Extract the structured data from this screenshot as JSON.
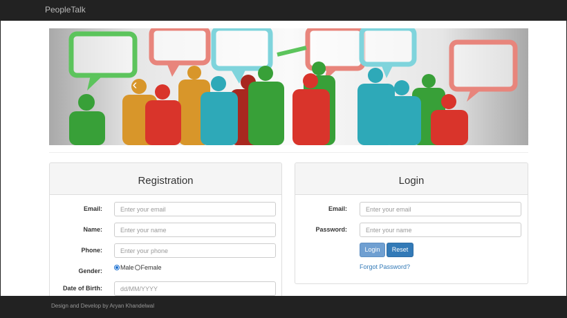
{
  "navbar": {
    "brand": "PeopleTalk"
  },
  "carousel": {
    "prev_icon": "chevron-left-icon",
    "next_icon": "chevron-right-icon"
  },
  "registration": {
    "title": "Registration",
    "email_label": "Email:",
    "email_placeholder": "Enter your email",
    "name_label": "Name:",
    "name_placeholder": "Enter your name",
    "phone_label": "Phone:",
    "phone_placeholder": "Enter your phone",
    "gender_label": "Gender:",
    "gender_options": [
      "Male",
      "Female"
    ],
    "gender_selected": "Male",
    "dob_label": "Date of Birth:",
    "dob_placeholder": "dd/MM/YYYY"
  },
  "login": {
    "title": "Login",
    "email_label": "Email:",
    "email_placeholder": "Enter your email",
    "password_label": "Password:",
    "password_placeholder": "Enter your name",
    "login_button": "Login",
    "reset_button": "Reset",
    "forgot_link": "Forgot Password?"
  },
  "footer": {
    "text": "Design and Develop by Aryan Khandelwal"
  },
  "colors": {
    "navbar": "#222222",
    "primary": "#337ab7",
    "login_button": "#6f9fd1"
  }
}
